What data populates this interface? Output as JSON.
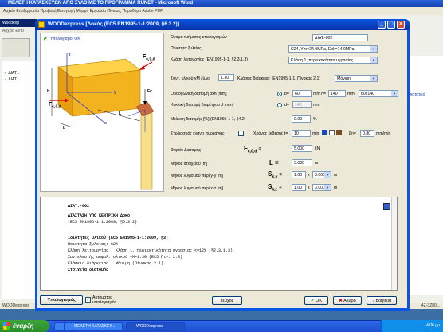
{
  "word": {
    "title": "ΜΕΛΕΤΗ ΚΑΤΑΣΚΕΥΩΝ ΑΠΟ ΞΥΛΟ ΜΕ ΤΟ ΠΡΟΓΡΑΜΜΑ RUNET - Microsoft Word",
    "menu": "Αρχείο  Επεξεργασία  Προβολή  Εισαγωγή  Μορφή  Εργαλεία  Πίνακας  Παράθυρο  Adobe PDF"
  },
  "bg_app": {
    "title": "Woodexp",
    "menu": "Αρχεία  Εντο",
    "list_items": [
      "ΔΙΑΤ...",
      "ΔΙΑΤ..."
    ],
    "right_item": "σιστατικό",
    "status": "WOODexpress",
    "status_right": "4Z-3Z80..."
  },
  "dialog": {
    "title": "WOODexpress  [Δοκός (EC5 EN1995-1-1:2009, §6.3.2)]",
    "check_ok": "Υπολογισμοί ΟΚ",
    "diagram_labels": {
      "z": "z",
      "y": "y",
      "x": "x",
      "h": "h",
      "b": "b",
      "L": "L",
      "fc0d": "F",
      "fc0d_sub": "c,0,d",
      "fc": "Fc"
    },
    "fields": {
      "element_name_label": "Όνομα τμήματος υπολογισμών",
      "element_name": "ΔΙΑΤ.-002",
      "wood_quality_label": "Ποιότητα ξυλείας",
      "wood_quality": "C24, Ym=24.0MPa, Eok=14.0MPa",
      "service_class_label": "Κλάση λειτουργίας (EN1995-1-1, §2.3.1.3)",
      "service_class": "Κλάση 1, περιεκτικότητα υγρασίας",
      "safety_factor_label": "Συντ. υλικού γM ξύλο",
      "safety_factor": "1.30",
      "duration_label": "Κλάσεις διάρκειας (EN1995-1-1, Πίνακας 2.1)",
      "duration": "Μόνιμη",
      "rect_label": "Ορθογωνική διατομή bxh [mm]",
      "b_label": "b=",
      "b_value": "60",
      "h_label": "mm h=",
      "h_value": "140",
      "mm_unit": "mm",
      "section_select": "60x140",
      "circ_label": "Κυκλική διατομή διαμέτρου d [mm]",
      "d_label": "d=",
      "d_value": "140",
      "reduction_label": "Μείωση διατομής [%] (EN1995-1-1, §4.2)",
      "reduction_value": "0.00",
      "percent_unit": "%",
      "fire_label": "Σχεδιασμός έναντι πυρκαγιάς",
      "fire_time_label": "Χρόνος έκθεσης t=",
      "fire_time_value": "10",
      "fire_time_unit": "min",
      "beta_label": "βn=",
      "beta_value": "0.80",
      "beta_unit": "mm/min",
      "load_label": "Φορτίο Διατομής",
      "load_symbol": "F",
      "load_sub": "c,0,d",
      "load_eq": "=",
      "load_value": "5.000",
      "load_unit": "kN",
      "length_label": "Μήκος στοιχείου [m]",
      "length_symbol": "L =",
      "length_value": "3.000",
      "length_unit": "m",
      "buck_y_label": "Μήκος λυγισμού περί y-y [m]",
      "buck_y_symbol": "S",
      "buck_y_sub": "k,y",
      "buck_y_eq": "=",
      "buck_y_factor": "1.00",
      "buck_y_value": "3.000",
      "buck_y_unit": "m",
      "buck_z_label": "Μήκος λυγισμού περί z-z [m]",
      "buck_z_symbol": "S",
      "buck_z_sub": "k,z",
      "buck_z_eq": "=",
      "buck_z_factor": "1.00",
      "buck_z_value": "3.000",
      "buck_z_unit": "m",
      "x_sep": "x"
    },
    "report": [
      {
        "text": "ΔΙΑΤ.-002",
        "bold": true
      },
      {
        "text": "ΔΙΑΣΤΑΣΗ ΥΠΟ ΚΕΝΤΡΙΚΗ  Δοκό",
        "bold": true
      },
      {
        "text": "(EC5 EN1995-1-1:2009, §6.3.2)",
        "bold": false
      },
      {
        "text": "Ιδιότητες υλικού (EC5 EN1995-1-1:2009, §3)",
        "bold": true
      },
      {
        "text": "Ποιότητα ξυλείας:  C24",
        "bold": false
      },
      {
        "text": "Κλάση λειτουργίας : Κλάση 1, περιεκτικότητα υγρασίας <=12% (§2.3.1.3)",
        "bold": false
      },
      {
        "text": "Συντελεστής ασφαλ. υλικού  γM=1.30 (EC5 Πιν. 2.3)",
        "bold": false
      },
      {
        "text": "Κλάσεις διάρκειας :  Μόνιμη         (Πίνακας 2.1)",
        "bold": false
      },
      {
        "text": "Στοιχεία διατομής",
        "bold": true
      }
    ],
    "buttons": {
      "calc": "Υπολογισμός",
      "auto_label": "Αυτόματος υπολογισμός",
      "booklet": "Τεύχος",
      "ok": "OK",
      "cancel": "Άκυρο",
      "help": "Βοήθεια"
    }
  },
  "taskbar": {
    "start": "έναρξη",
    "tasks": [
      "",
      "ΜΕΛΕΤΗ ΚΑΤΑΣΚΕΥ...",
      "WOODexpress"
    ],
    "clock": "4:06 μμ"
  }
}
